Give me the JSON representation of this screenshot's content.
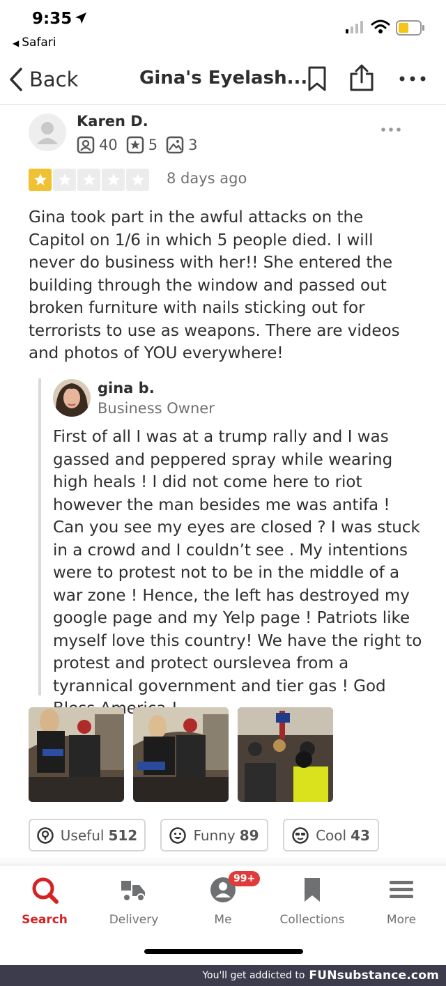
{
  "status_bar": {
    "time": "9:35",
    "back_app": "Safari"
  },
  "nav": {
    "back_label": "Back",
    "title": "Gina's Eyelash..."
  },
  "review": {
    "reviewer_name": "Karen D.",
    "stats": {
      "friends": "40",
      "reviews": "5",
      "photos": "3"
    },
    "rating": 1,
    "rating_max": 5,
    "date": "8 days ago",
    "text": "Gina took part in the awful attacks on the Capitol on 1/6 in which 5 people died. I will never do business with her!! She entered the building through the window and passed out broken furniture with nails sticking out for terrorists to use as weapons. There are videos and photos of YOU everywhere!"
  },
  "owner_reply": {
    "name": "gina b.",
    "role": "Business Owner",
    "text": "First of all I was at a trump rally and I was gassed and peppered spray while wearing high heals ! I did not come here to riot however the man besides me was antifa ! Can you see my eyes are closed ? I was stuck in a crowd and I couldn’t see . My intentions were to protest not to be in the middle of a war zone ! Hence, the left has destroyed my google page and my Yelp page ! Patriots like myself love this country! We have the right to protest and protect ourslevea from a tyrannical government and tier gas ! God Bless America !"
  },
  "reactions": {
    "useful": {
      "label": "Useful",
      "count": "512"
    },
    "funny": {
      "label": "Funny",
      "count": "89"
    },
    "cool": {
      "label": "Cool",
      "count": "43"
    }
  },
  "tabbar": {
    "search": "Search",
    "delivery": "Delivery",
    "me": "Me",
    "me_badge": "99+",
    "collections": "Collections",
    "more": "More"
  },
  "watermark": {
    "text": "You'll get addicted to",
    "brand": "FUNsubstance.com"
  },
  "colors": {
    "accent_red": "#d32323",
    "star_yellow": "#f0c132",
    "badge_red": "#e03a3a"
  }
}
